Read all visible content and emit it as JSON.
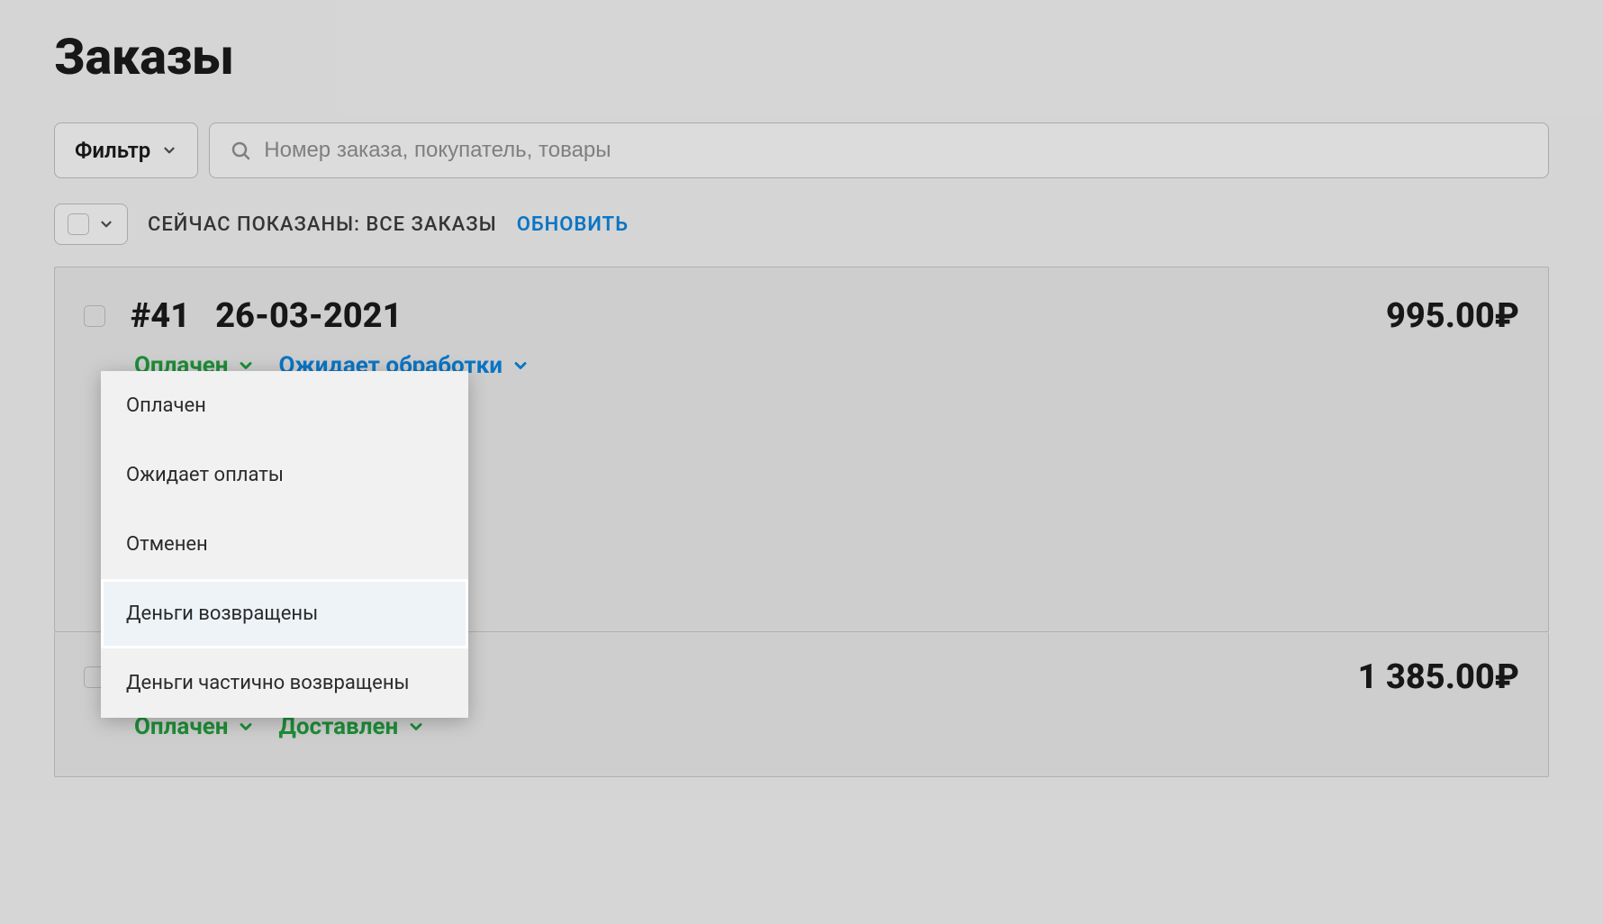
{
  "page": {
    "title": "Заказы"
  },
  "toolbar": {
    "filter_label": "Фильтр",
    "search_placeholder": "Номер заказа, покупатель, товары"
  },
  "meta": {
    "status_text": "СЕЙЧАС ПОКАЗАНЫ: ВСЕ ЗАКАЗЫ",
    "refresh_label": "ОБНОВИТЬ"
  },
  "orders": [
    {
      "number": "#41",
      "date": "26-03-2021",
      "price": "995.00₽",
      "payment_status": "Оплачен",
      "fulfillment_status": "Ожидает обработки"
    },
    {
      "price": "1 385.00₽",
      "payment_status": "Оплачен",
      "fulfillment_status": "Доставлен"
    }
  ],
  "payment_status_dropdown": {
    "items": [
      "Оплачен",
      "Ожидает оплаты",
      "Отменен",
      "Деньги возвращены",
      "Деньги частично возвращены"
    ],
    "highlighted_index": 3
  },
  "colors": {
    "green": "#209a3c",
    "blue": "#0b7fd6"
  }
}
